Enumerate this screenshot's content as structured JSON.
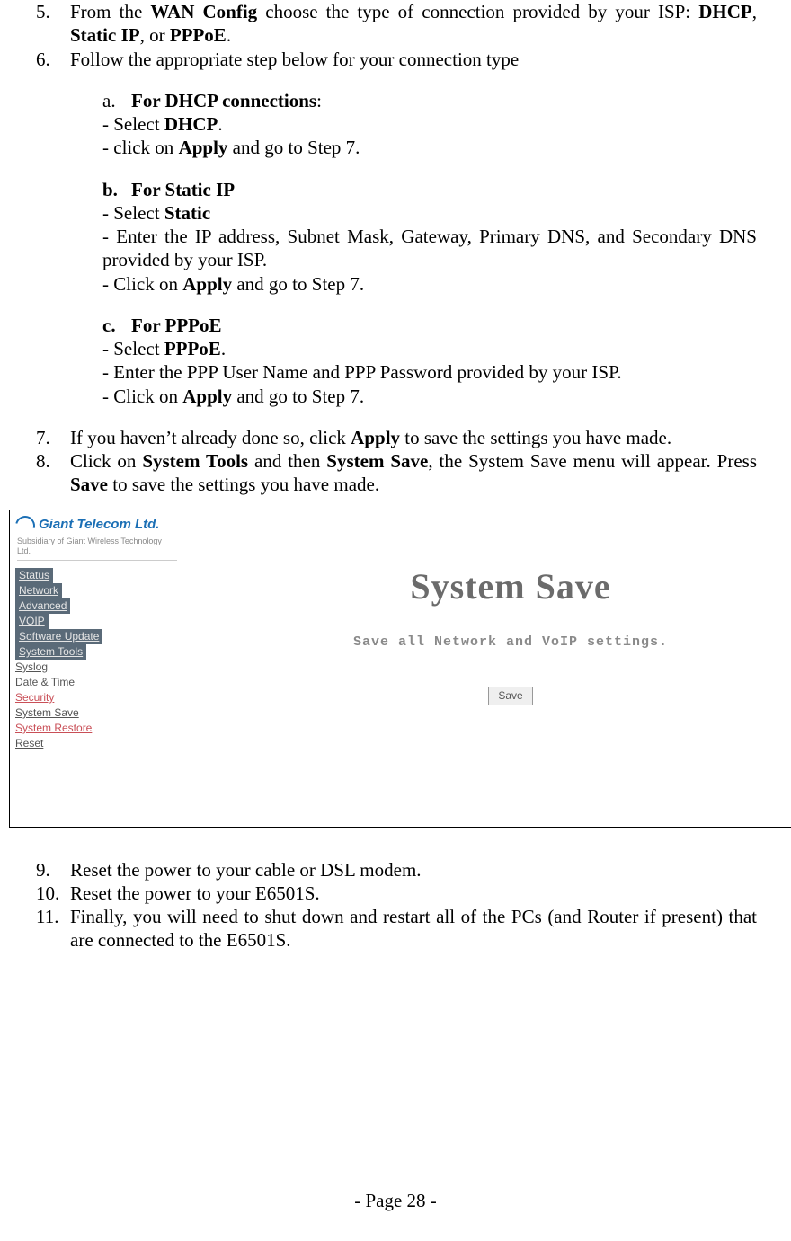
{
  "list": {
    "item5_num": "5.",
    "item5_pre": "From the ",
    "item5_b1": "WAN Config",
    "item5_mid": " choose the type of connection provided by your ISP: ",
    "item5_b2": "DHCP",
    "item5_sep1": ", ",
    "item5_b3": "Static IP",
    "item5_sep2": ", or ",
    "item5_b4": "PPPoE",
    "item5_end": ".",
    "item6_num": "6.",
    "item6_text": "Follow the appropriate step below for your connection type",
    "item7_num": "7.",
    "item7_pre": "If you haven’t already done so, click ",
    "item7_b": "Apply",
    "item7_post": " to save the settings you have made.",
    "item8_num": "8.",
    "item8_pre": "Click on ",
    "item8_b1": "System Tools",
    "item8_mid1": " and then ",
    "item8_b2": "System Save",
    "item8_mid2": ", the System Save menu will appear. Press ",
    "item8_b3": "Save",
    "item8_post": " to save the settings you have made.",
    "item9_num": "9.",
    "item9_text": "Reset the power to your cable or DSL modem.",
    "item10_num": "10.",
    "item10_text": "Reset the power to your E6501S.",
    "item11_num": "11.",
    "item11_text": "Finally, you will need to shut down and restart all of the PCs (and Router if present) that are connected to the E6501S."
  },
  "sub": {
    "a_num": "a.",
    "a_title": "For DHCP connections",
    "a_title_post": ":",
    "a_l1_pre": "- Select ",
    "a_l1_b": "DHCP",
    "a_l1_post": ".",
    "a_l2_pre": "- click on ",
    "a_l2_b": "Apply",
    "a_l2_post": " and go to Step 7.",
    "b_num": "b.",
    "b_title": "For Static IP",
    "b_l1_pre": "- Select ",
    "b_l1_b": "Static",
    "b_l2": "- Enter the IP address, Subnet Mask, Gateway, Primary DNS, and Secondary DNS provided by your ISP.",
    "b_l3_pre": "- Click on ",
    "b_l3_b": "Apply",
    "b_l3_post": " and go to Step 7.",
    "c_num": "c.",
    "c_title": "For PPPoE",
    "c_l1_pre": "- Select ",
    "c_l1_b": "PPPoE",
    "c_l1_post": ".",
    "c_l2": "- Enter the PPP User Name and PPP Password provided by your ISP.",
    "c_l3_pre": "- Click on ",
    "c_l3_b": "Apply",
    "c_l3_post": " and go to Step 7."
  },
  "screenshot": {
    "brand": "Giant Telecom Ltd.",
    "brand_sub": "Subsidiary of Giant Wireless Technology Ltd.",
    "nav": {
      "status": "Status",
      "network": "Network",
      "advanced": "Advanced",
      "voip": "VOIP",
      "update": "Software Update",
      "tools": "System Tools",
      "syslog": "Syslog",
      "datetime": "Date & Time",
      "security": "Security",
      "syssave": "System Save",
      "sysrestore": "System Restore",
      "reset": "Reset"
    },
    "main_title": "System Save",
    "main_desc": "Save all Network and VoIP settings.",
    "save_btn": "Save"
  },
  "footer": "- Page 28 -"
}
